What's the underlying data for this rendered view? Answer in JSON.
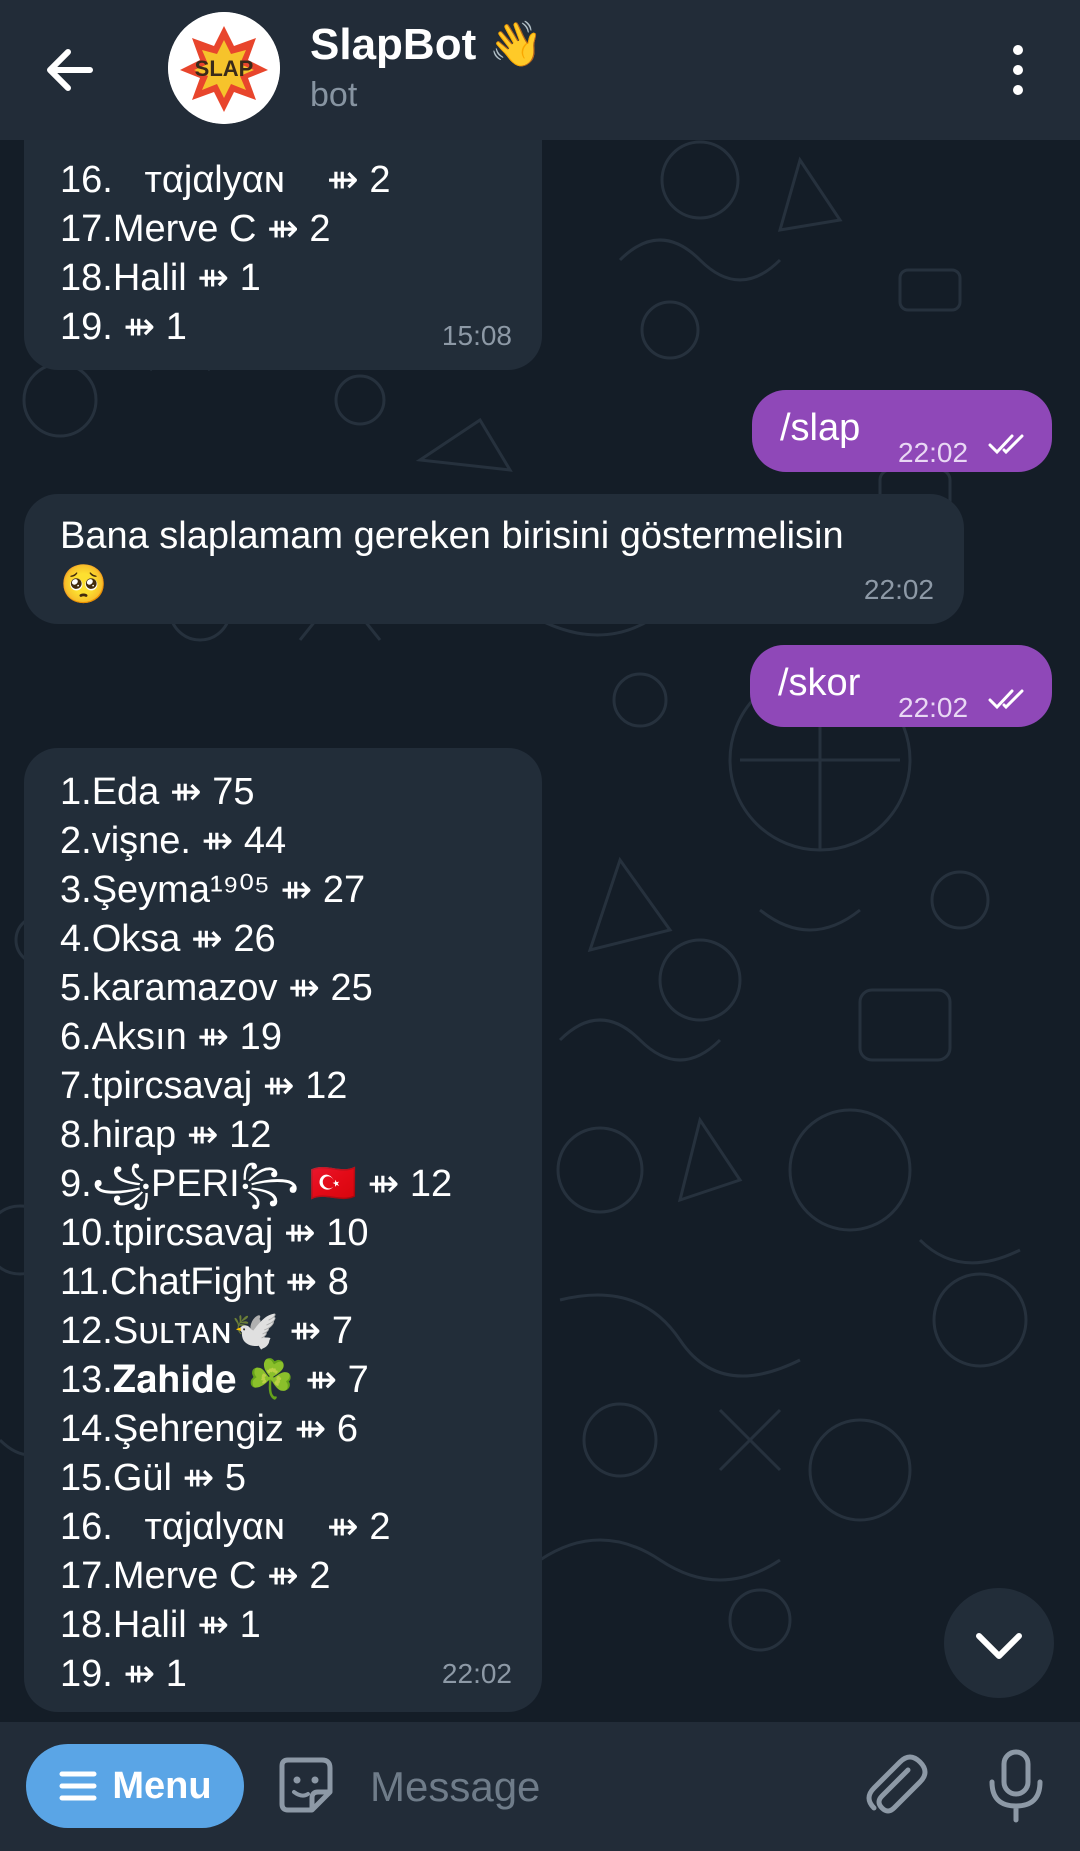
{
  "header": {
    "title": "SlapBot 👋",
    "subtitle": "bot",
    "avatar_text": "SLAP"
  },
  "messages": [
    {
      "direction": "incoming",
      "lines": [
        "16.   ᴛαjαlyαɴ    ⇻ 2",
        "17.Merve C ⇻ 2",
        "18.Halil ⇻ 1",
        "19. ⇻ 1"
      ],
      "time": "15:08"
    },
    {
      "direction": "outgoing",
      "text": "/slap",
      "time": "22:02",
      "status": "read"
    },
    {
      "direction": "incoming",
      "lines": [
        "Bana slaplamam gereken birisini göstermelisin",
        "🥺"
      ],
      "time": "22:02"
    },
    {
      "direction": "outgoing",
      "text": "/skor",
      "time": "22:02",
      "status": "read"
    },
    {
      "direction": "incoming",
      "lines": [
        "1.Eda ⇻ 75",
        "2.vişne. ⇻ 44",
        "3.Şeyma¹⁹⁰⁵ ⇻ 27",
        "4.Oksa ⇻ 26",
        "5.karamazov ⇻ 25",
        "6.Aksın ⇻ 19",
        "7.tpircsavaj ⇻ 12",
        "8.hirap ⇻ 12",
        "9.꧁PΕRI꧂ 🇹🇷 ⇻ 12",
        "10.tpircsavaj ⇻ 10",
        "11.ChatFight ⇻ 8",
        "12.Sᴜʟᴛᴀɴ🕊️ ⇻ 7",
        "13.𝐙𝐚𝐡𝐢𝐝𝐞 ☘️ ⇻ 7",
        "14.Şehrengiz ⇻ 6",
        "15.Gül ⇻ 5",
        "16.   ᴛαjαlyαɴ    ⇻ 2",
        "17.Merve C ⇻ 2",
        "18.Halil ⇻ 1",
        "19. ⇻ 1"
      ],
      "time": "22:02"
    }
  ],
  "composer": {
    "menu_label": "Menu",
    "placeholder": "Message"
  },
  "icons": {
    "back": "arrow-left-icon",
    "more": "vertical-dots-icon",
    "scroll": "chevron-down-icon",
    "menu": "hamburger-icon",
    "sticker": "sticker-icon",
    "attach": "paperclip-icon",
    "mic": "microphone-icon"
  },
  "colors": {
    "header_bg": "#222c38",
    "chat_bg": "#141d27",
    "incoming_bubble": "#222d39",
    "outgoing_bubble": "#8f48b8",
    "menu_button": "#5aa5e6"
  }
}
